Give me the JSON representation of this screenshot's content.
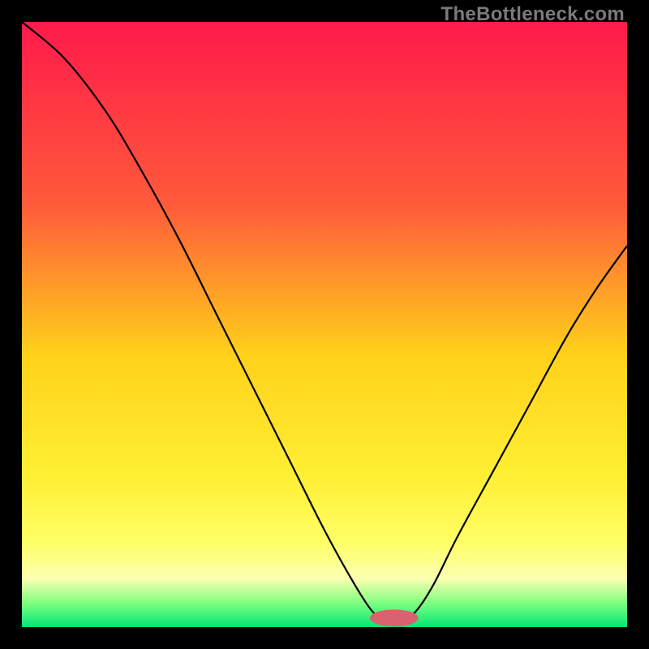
{
  "watermark": "TheBottleneck.com",
  "chart_data": {
    "type": "line",
    "title": "",
    "xlabel": "",
    "ylabel": "",
    "xlim": [
      0,
      100
    ],
    "ylim": [
      0,
      100
    ],
    "gradient_stops": [
      {
        "offset": 0,
        "color": "#ff1a4b"
      },
      {
        "offset": 0.3,
        "color": "#ff5a3a"
      },
      {
        "offset": 0.55,
        "color": "#ffd11a"
      },
      {
        "offset": 0.75,
        "color": "#ffef33"
      },
      {
        "offset": 0.86,
        "color": "#ffff66"
      },
      {
        "offset": 0.92,
        "color": "#fbffb0"
      },
      {
        "offset": 0.96,
        "color": "#80ff80"
      },
      {
        "offset": 1.0,
        "color": "#00e676"
      }
    ],
    "curve": [
      {
        "x": 0,
        "y": 100
      },
      {
        "x": 7,
        "y": 94
      },
      {
        "x": 14,
        "y": 85
      },
      {
        "x": 20,
        "y": 75
      },
      {
        "x": 26,
        "y": 64
      },
      {
        "x": 32,
        "y": 52
      },
      {
        "x": 38,
        "y": 40
      },
      {
        "x": 44,
        "y": 28
      },
      {
        "x": 50,
        "y": 16
      },
      {
        "x": 55,
        "y": 7
      },
      {
        "x": 58,
        "y": 2.5
      },
      {
        "x": 60,
        "y": 1.5
      },
      {
        "x": 63,
        "y": 1.5
      },
      {
        "x": 65,
        "y": 2.5
      },
      {
        "x": 68,
        "y": 7
      },
      {
        "x": 72,
        "y": 15
      },
      {
        "x": 78,
        "y": 26
      },
      {
        "x": 84,
        "y": 37
      },
      {
        "x": 90,
        "y": 48
      },
      {
        "x": 95,
        "y": 56
      },
      {
        "x": 100,
        "y": 63
      }
    ],
    "marker": {
      "x": 61.5,
      "y": 1.5,
      "rx": 4.0,
      "ry": 1.4,
      "color": "#d9626e"
    }
  }
}
